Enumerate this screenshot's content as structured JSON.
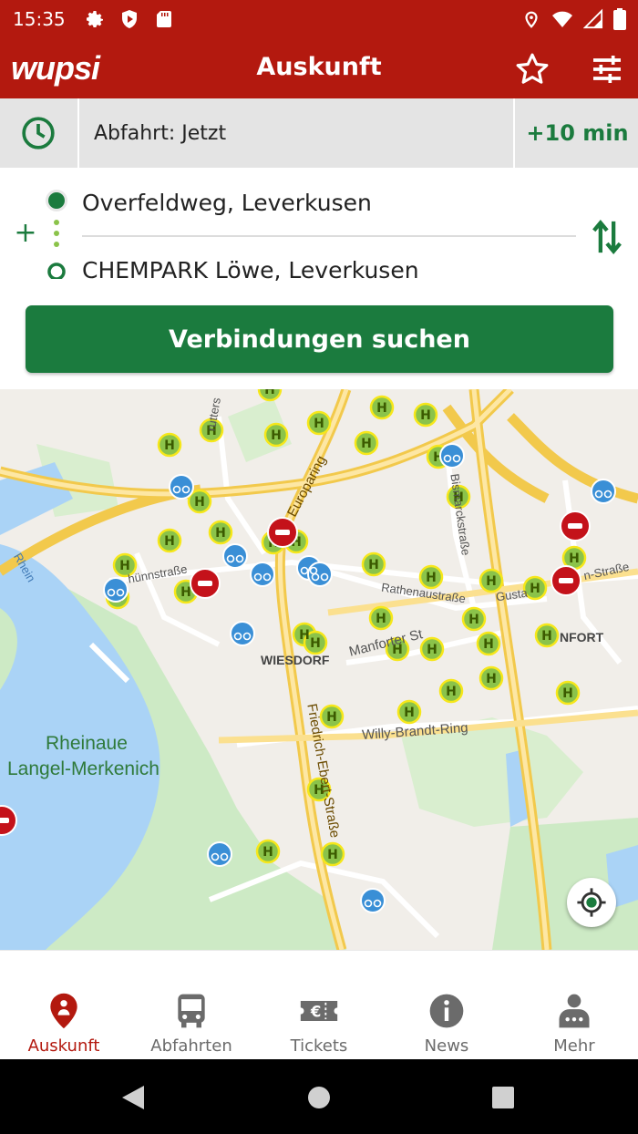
{
  "status_bar": {
    "time": "15:35"
  },
  "app_bar": {
    "logo": "wupsi",
    "title": "Auskunft"
  },
  "time_row": {
    "departure_label": "Abfahrt:",
    "departure_value": "Jetzt",
    "plus_button": "+10 min"
  },
  "route": {
    "from": "Overfeldweg, Leverkusen",
    "to": "CHEMPARK Löwe, Leverkusen",
    "add_via": "+",
    "search_button": "Verbindungen suchen"
  },
  "map": {
    "labels": {
      "europaring": "Europaring",
      "rhein": "Rhein",
      "wiesdorf": "WIESDORF",
      "manforter": "Manforter St",
      "rathenau": "Rathenaustraße",
      "willy": "Willy-Brandt-Ring",
      "rheinaue1": "Rheinaue",
      "rheinaue2": "Langel-Merkenich",
      "friedrich": "Friedrich-Ebert-Straße",
      "manfort": "NFORT",
      "gusta": "Gusta",
      "nstrasse": "n-Straße",
      "huennstr": "hünnstraße",
      "bismarck": "Bismarckstraße",
      "rutters": "rutters"
    },
    "colors": {
      "land": "#f1eee9",
      "water": "#aad3f6",
      "park": "#cdeac5",
      "road": "#fbe08f"
    }
  },
  "bottom_nav": [
    {
      "label": "Auskunft",
      "icon": "location-pin-icon",
      "active": true
    },
    {
      "label": "Abfahrten",
      "icon": "bus-icon",
      "active": false
    },
    {
      "label": "Tickets",
      "icon": "ticket-icon",
      "active": false
    },
    {
      "label": "News",
      "icon": "info-icon",
      "active": false
    },
    {
      "label": "Mehr",
      "icon": "more-person-icon",
      "active": false
    }
  ],
  "colors": {
    "brand_red": "#b3190f",
    "brand_green": "#1b7b3e"
  }
}
